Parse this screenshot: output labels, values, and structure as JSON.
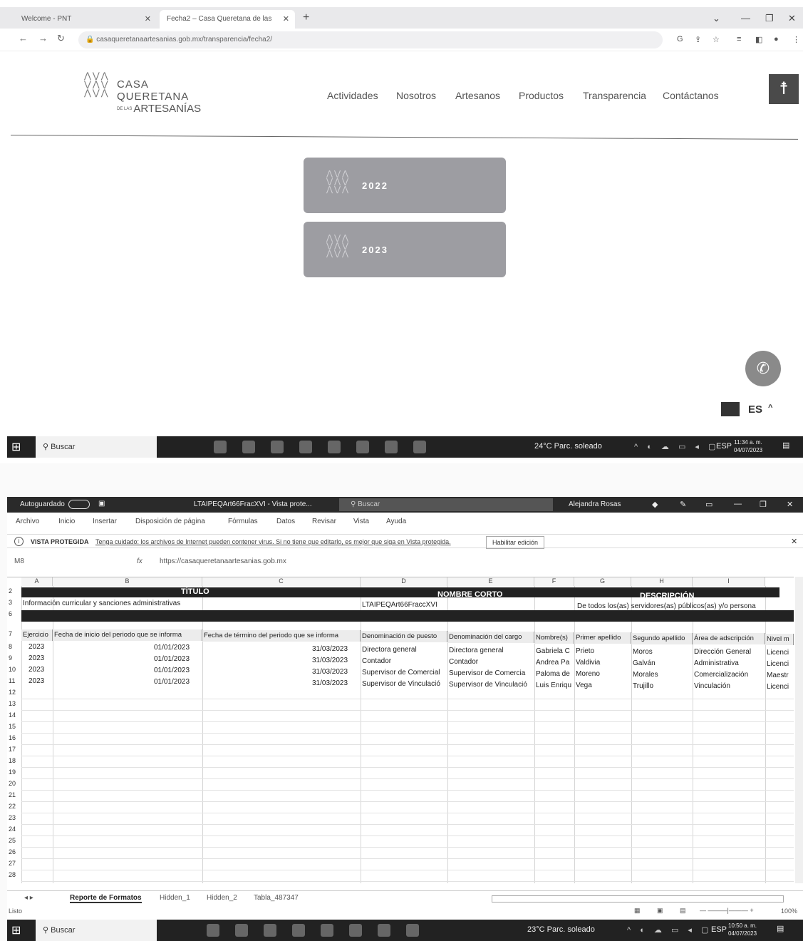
{
  "browser": {
    "tabs": [
      {
        "label": "Welcome - PNT"
      },
      {
        "label": "Fecha2 – Casa Queretana de las"
      }
    ],
    "url": "casaqueretanaartesanias.gob.mx/transparencia/fecha2/"
  },
  "site": {
    "logo_lines": [
      "CASA",
      "QUERETANA",
      "DE LAS",
      "ARTESANÍAS"
    ],
    "menu": [
      "Actividades",
      "Nosotros",
      "Artesanos",
      "Productos",
      "Transparencia",
      "Contáctanos"
    ],
    "years": [
      "2022",
      "2023"
    ],
    "language": "ES"
  },
  "taskbar1": {
    "search": "Buscar",
    "weather": "24°C  Parc. soleado",
    "lang": "ESP",
    "time": "11:34 a. m.",
    "date": "04/07/2023"
  },
  "excel": {
    "autosave": "Autoguardado",
    "filename": "LTAIPEQArt66FracXVI  -  Vista prote...",
    "search": "Buscar",
    "user": "Alejandra Rosas",
    "ribbon": [
      "Archivo",
      "Inicio",
      "Insertar",
      "Disposición de página",
      "Fórmulas",
      "Datos",
      "Revisar",
      "Vista",
      "Ayuda"
    ],
    "protected_label": "VISTA PROTEGIDA",
    "protected_msg": "Tenga cuidado: los archivos de Internet pueden contener virus. Si no tiene que editarlo, es mejor que siga en Vista protegida.",
    "enable_button": "Habilitar edición",
    "cell_ref": "M8",
    "formula": "https://casaqueretanaartesanias.gob.mx",
    "columns": [
      "A",
      "B",
      "C",
      "D",
      "E",
      "F",
      "G",
      "H",
      "I"
    ],
    "row_numbers": [
      "2",
      "3",
      "6",
      "7",
      "8",
      "9",
      "10",
      "11",
      "12",
      "13",
      "14",
      "15",
      "16",
      "17",
      "18",
      "19",
      "20",
      "21",
      "22",
      "23",
      "24",
      "25",
      "26",
      "27",
      "28"
    ],
    "titles": {
      "titulo": "TÍTULO",
      "nombre_corto": "NOMBRE CORTO",
      "descripcion": "DESCRIPCIÓN"
    },
    "row3": {
      "a": "Información curricular y sanciones administrativas",
      "d": "LTAIPEQArt66FraccXVI",
      "g": "De todos los(as) servidores(as) públicos(as) y/o persona"
    },
    "headers": [
      "Ejercicio",
      "Fecha de inicio del periodo que se informa",
      "Fecha de término del periodo que se informa",
      "Denominación de puesto",
      "Denominación del cargo",
      "Nombre(s)",
      "Primer apellido",
      "Segundo apellido",
      "Área de adscripción",
      "Nivel m"
    ],
    "rows": [
      [
        "2023",
        "01/01/2023",
        "31/03/2023",
        "Directora general",
        "Directora general",
        "Gabriela C",
        "Prieto",
        "Moros",
        "Dirección General",
        "Licenci"
      ],
      [
        "2023",
        "01/01/2023",
        "31/03/2023",
        "Contador",
        "Contador",
        "Andrea Pa",
        "Valdivia",
        "Galván",
        "Administrativa",
        "Licenci"
      ],
      [
        "2023",
        "01/01/2023",
        "31/03/2023",
        "Supervisor de Comercial",
        "Supervisor de Comercia",
        "Paloma de",
        "Moreno",
        "Morales",
        "Comercialización",
        "Maestr"
      ],
      [
        "2023",
        "01/01/2023",
        "31/03/2023",
        "Supervisor de Vinculació",
        "Supervisor de Vinculació",
        "Luis Enriqu",
        "Vega",
        "Trujillo",
        "Vinculación",
        "Licenci"
      ]
    ],
    "sheets": [
      "Reporte de Formatos",
      "Hidden_1",
      "Hidden_2",
      "Tabla_487347"
    ],
    "status": "Listo",
    "zoom": "100%"
  },
  "taskbar2": {
    "search": "Buscar",
    "weather": "23°C  Parc. soleado",
    "lang": "ESP",
    "time": "10:50 a. m.",
    "date": "04/07/2023"
  }
}
